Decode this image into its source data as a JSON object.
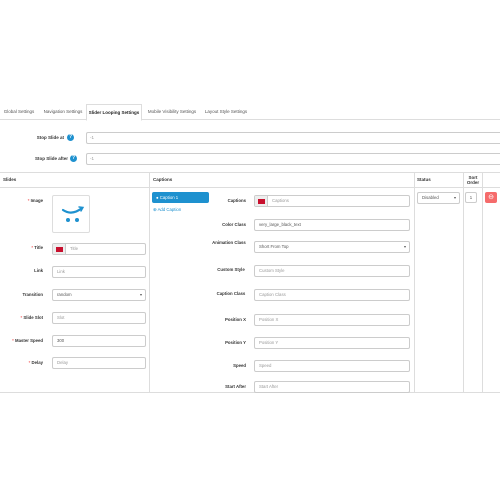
{
  "tabs": [
    {
      "label": "Global Settings"
    },
    {
      "label": "Navigation Settings"
    },
    {
      "label": "Slider Looping Settings"
    },
    {
      "label": "Mobile Visibility Settings"
    },
    {
      "label": "Layout Style Settings"
    }
  ],
  "looping": {
    "stop_slide_at_label": "Stop Slide at",
    "stop_slide_at_value": "-1",
    "stop_slide_after_label": "Stop Slide after",
    "stop_slide_after_value": "-1"
  },
  "slides": {
    "header": "Slides",
    "image_label": "Image",
    "title_label": "Title",
    "title_placeholder": "Title",
    "link_label": "Link",
    "link_placeholder": "Link",
    "transition_label": "Transition",
    "transition_value": "random",
    "slide_slot_label": "Slide Slot",
    "slide_slot_placeholder": "Slot",
    "master_speed_label": "Master Speed",
    "master_speed_value": "300",
    "delay_label": "Delay",
    "delay_placeholder": "Delay"
  },
  "captions": {
    "header": "Captions",
    "active_caption": "Caption 1",
    "add_caption": "Add Caption",
    "captions_label": "Captions",
    "captions_placeholder": "Captions",
    "color_class_label": "Color Class",
    "color_class_value": "very_large_black_text",
    "animation_class_label": "Animation Class",
    "animation_class_value": "Short From Top",
    "custom_style_label": "Custom Style",
    "custom_style_placeholder": "Custom Style",
    "caption_class_label": "Caption Class",
    "caption_class_placeholder": "Caption Class",
    "position_x_label": "Position X",
    "position_x_placeholder": "Position X",
    "position_y_label": "Position Y",
    "position_y_placeholder": "Position Y",
    "speed_label": "Speed",
    "speed_placeholder": "Speed",
    "start_after_label": "Start After",
    "start_after_placeholder": "Start After"
  },
  "status": {
    "header": "Status",
    "value": "Disabled"
  },
  "sort_order": {
    "header": "Sort Order",
    "value": "1"
  },
  "colors": {
    "primary": "#1e91cf",
    "danger": "#f56b6b",
    "border": "#dddddd"
  },
  "icons": {
    "help": "question-circle-icon",
    "delete": "minus-circle-icon",
    "caption": "circle-icon",
    "add": "plus-circle-icon",
    "flag": "uk-flag-icon",
    "select": "caret-down-icon"
  }
}
